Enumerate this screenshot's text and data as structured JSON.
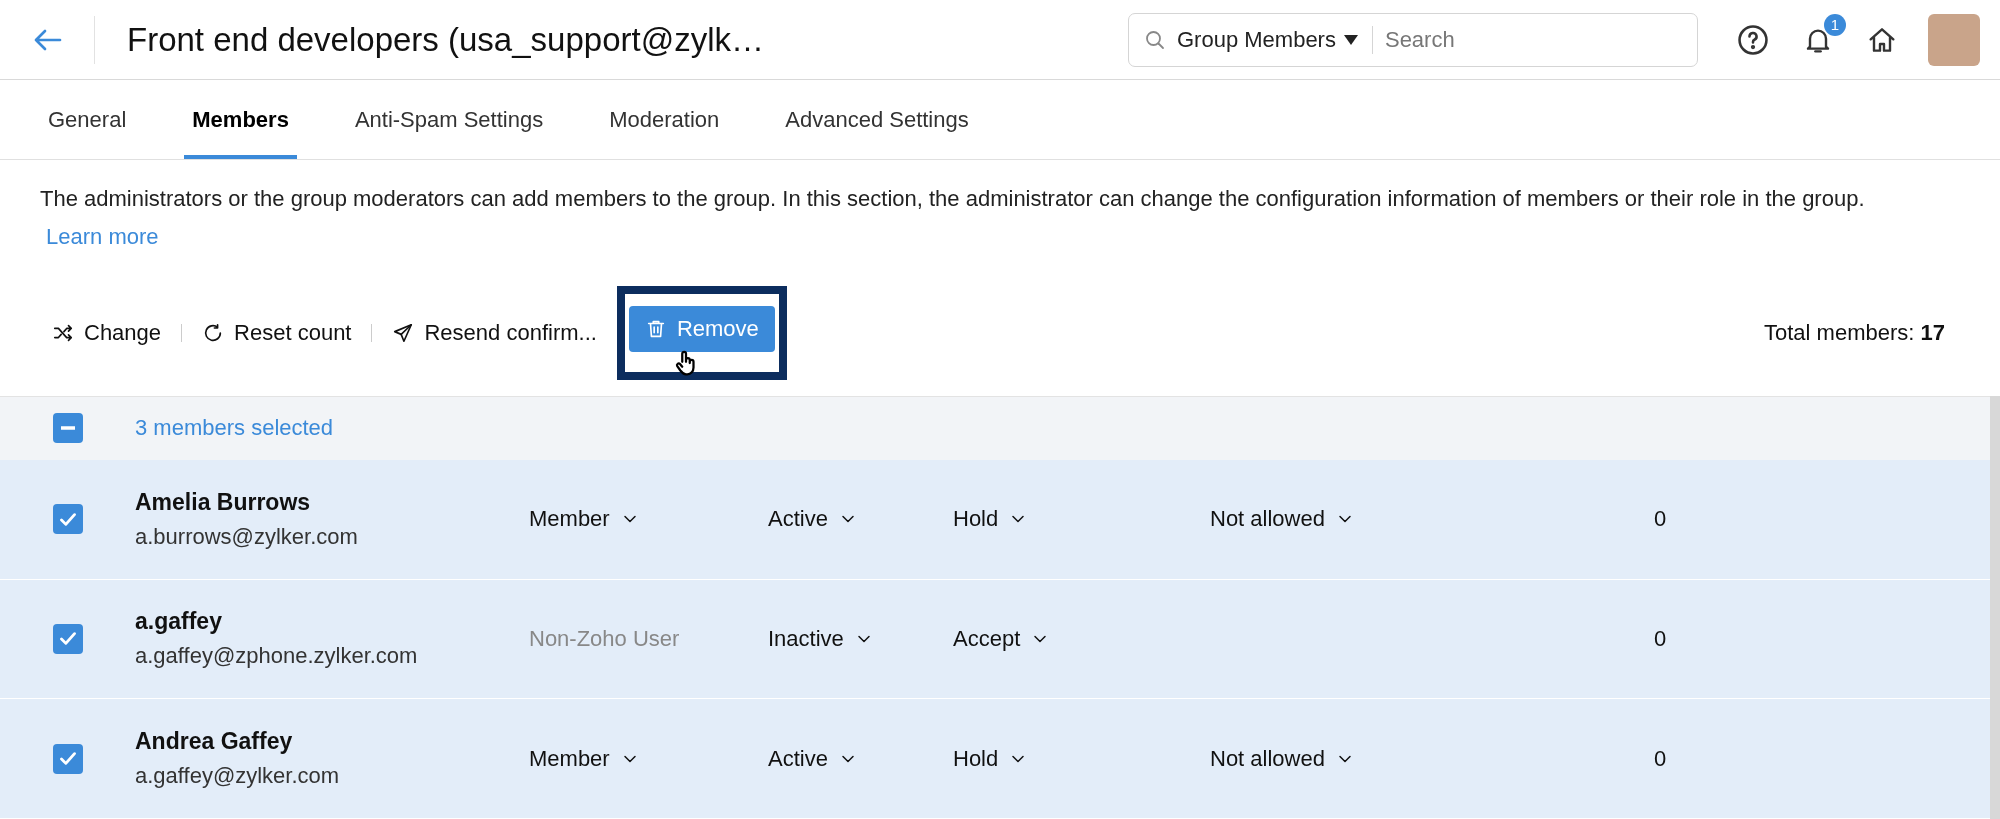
{
  "header": {
    "title": "Front end developers (usa_support@zylk…",
    "search": {
      "scope": "Group Members",
      "placeholder": "Search"
    },
    "notification_count": "1"
  },
  "tabs": [
    {
      "label": "General",
      "selected": false
    },
    {
      "label": "Members",
      "selected": true
    },
    {
      "label": "Anti-Spam Settings",
      "selected": false
    },
    {
      "label": "Moderation",
      "selected": false
    },
    {
      "label": "Advanced Settings",
      "selected": false
    }
  ],
  "description": {
    "text": "The administrators or the group moderators can add members to the group. In this section, the administrator can change the configuration information of members or their role in the group.",
    "link": "Learn more"
  },
  "toolbar": {
    "actions": [
      {
        "kind": "shuffle",
        "label": "Change"
      },
      {
        "kind": "reset",
        "label": "Reset count"
      },
      {
        "kind": "send",
        "label": "Resend confirm..."
      }
    ],
    "remove": {
      "label": "Remove",
      "highlighted": true
    },
    "total": "Total members: **17**"
  },
  "selection": {
    "label": "3 members selected",
    "indeterminate": true
  },
  "members": [
    {
      "name": "Amelia Burrows",
      "email": "a.burrows@zylker.com",
      "selected": true,
      "role": {
        "label": "Member",
        "editable": true
      },
      "status": "Active",
      "moderation": "Hold",
      "posting": "Not allowed",
      "count": "0"
    },
    {
      "name": "a.gaffey",
      "email": "a.gaffey@zphone.zylker.com",
      "selected": true,
      "role": {
        "label": "Non-Zoho User",
        "editable": false
      },
      "status": "Inactive",
      "moderation": "Accept",
      "count": "0"
    },
    {
      "name": "Andrea Gaffey",
      "email": "a.gaffey@zylker.com",
      "selected": true,
      "role": {
        "label": "Member",
        "editable": true
      },
      "status": "Active",
      "moderation": "Hold",
      "posting": "Not allowed",
      "count": "0"
    }
  ]
}
